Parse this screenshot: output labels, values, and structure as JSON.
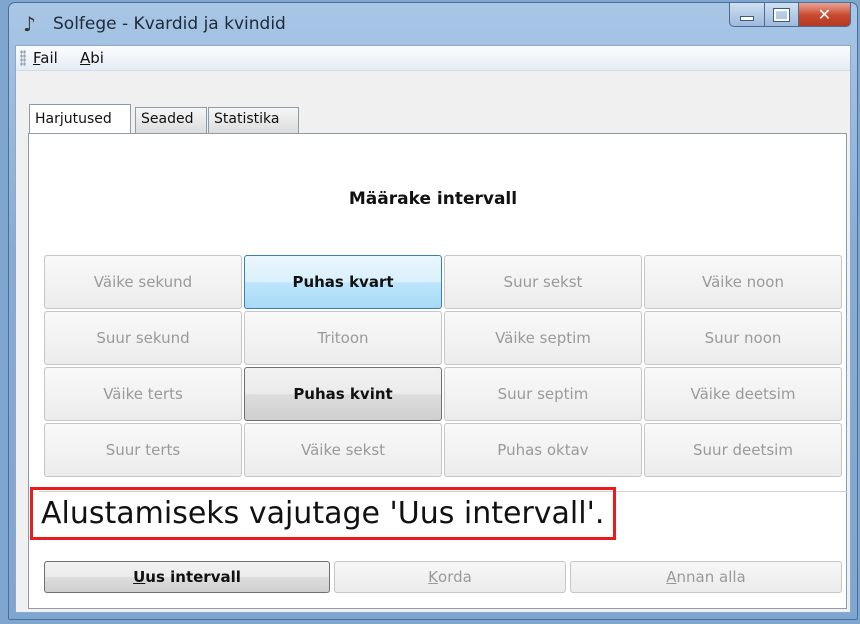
{
  "window": {
    "title": "Solfege - Kvardid ja kvindid"
  },
  "menu": [
    {
      "label": "Fail",
      "mnemonic": "F",
      "rest": "ail"
    },
    {
      "label": "Abi",
      "mnemonic": "A",
      "rest": "bi"
    }
  ],
  "tabs": [
    "Harjutused",
    "Seaded",
    "Statistika"
  ],
  "active_tab": "Harjutused",
  "heading": "Määrake intervall",
  "intervals": [
    [
      "Väike sekund",
      "Puhas kvart",
      "Suur sekst",
      "Väike noon"
    ],
    [
      "Suur sekund",
      "Tritoon",
      "Väike septim",
      "Suur noon"
    ],
    [
      "Väike terts",
      "Puhas kvint",
      "Suur septim",
      "Väike deetsim"
    ],
    [
      "Suur terts",
      "Väike sekst",
      "Puhas oktav",
      "Suur deetsim"
    ]
  ],
  "enabled_intervals": [
    "Puhas kvart",
    "Puhas kvint"
  ],
  "highlighted_interval": "Puhas kvart",
  "status_text": "Alustamiseks vajutage 'Uus intervall'.",
  "buttons": {
    "new": {
      "mnemonic": "U",
      "rest": "us intervall",
      "enabled": true
    },
    "repeat": {
      "mnemonic": "K",
      "rest": "orda",
      "enabled": false
    },
    "giveup": {
      "mnemonic": "A",
      "rest": "nnan alla",
      "enabled": false
    }
  },
  "colors": {
    "status_border": "#e81c1c",
    "highlight": "#bee6fd",
    "close_button": "#c9482e"
  },
  "icons": {
    "app": "music-note-icon"
  }
}
